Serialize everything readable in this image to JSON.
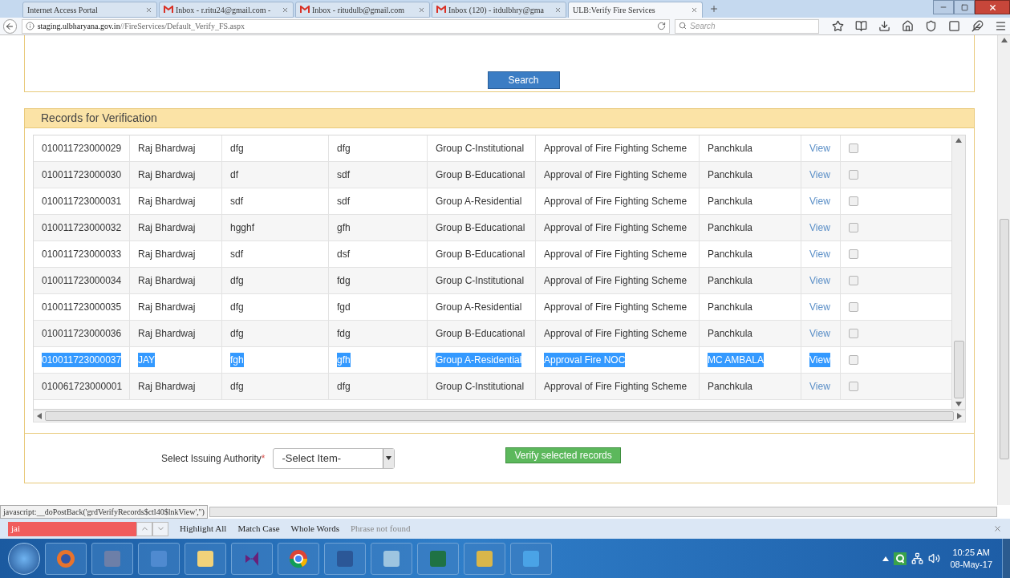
{
  "browser": {
    "tabs": [
      {
        "title": "Internet Access Portal",
        "mail": false,
        "selected": false
      },
      {
        "title": "Inbox - r.ritu24@gmail.com -",
        "mail": true,
        "selected": false
      },
      {
        "title": "Inbox - ritudulb@gmail.com",
        "mail": true,
        "selected": false
      },
      {
        "title": "Inbox (120) - itdulbhry@gma",
        "mail": true,
        "selected": false
      },
      {
        "title": "ULB:Verify Fire Services",
        "mail": false,
        "selected": true
      }
    ],
    "url_host": "staging.ulbharyana.gov.in",
    "url_path": "//FireServices/Default_Verify_FS.aspx",
    "search_placeholder": "Search"
  },
  "search_button": "Search",
  "records": {
    "title": "Records for Verification",
    "rows": [
      {
        "cells": [
          "010011723000029",
          "Raj Bhardwaj",
          "dfg",
          "dfg",
          "Group C-Institutional",
          "Approval of Fire Fighting Scheme",
          "Panchkula"
        ],
        "link": "View",
        "highlighted": false,
        "checked": false
      },
      {
        "cells": [
          "010011723000030",
          "Raj Bhardwaj",
          "df",
          "sdf",
          "Group B-Educational",
          "Approval of Fire Fighting Scheme",
          "Panchkula"
        ],
        "link": "View",
        "highlighted": false,
        "checked": false
      },
      {
        "cells": [
          "010011723000031",
          "Raj Bhardwaj",
          "sdf",
          "sdf",
          "Group A-Residential",
          "Approval of Fire Fighting Scheme",
          "Panchkula"
        ],
        "link": "View",
        "highlighted": false,
        "checked": false
      },
      {
        "cells": [
          "010011723000032",
          "Raj Bhardwaj",
          "hgghf",
          "gfh",
          "Group B-Educational",
          "Approval of Fire Fighting Scheme",
          "Panchkula"
        ],
        "link": "View",
        "highlighted": false,
        "checked": false
      },
      {
        "cells": [
          "010011723000033",
          "Raj Bhardwaj",
          "sdf",
          "dsf",
          "Group B-Educational",
          "Approval of Fire Fighting Scheme",
          "Panchkula"
        ],
        "link": "View",
        "highlighted": false,
        "checked": false
      },
      {
        "cells": [
          "010011723000034",
          "Raj Bhardwaj",
          "dfg",
          "fdg",
          "Group C-Institutional",
          "Approval of Fire Fighting Scheme",
          "Panchkula"
        ],
        "link": "View",
        "highlighted": false,
        "checked": false
      },
      {
        "cells": [
          "010011723000035",
          "Raj Bhardwaj",
          "dfg",
          "fgd",
          "Group A-Residential",
          "Approval of Fire Fighting Scheme",
          "Panchkula"
        ],
        "link": "View",
        "highlighted": false,
        "checked": false
      },
      {
        "cells": [
          "010011723000036",
          "Raj Bhardwaj",
          "dfg",
          "fdg",
          "Group B-Educational",
          "Approval of Fire Fighting Scheme",
          "Panchkula"
        ],
        "link": "View",
        "highlighted": false,
        "checked": false
      },
      {
        "cells": [
          "010011723000037",
          "JAY",
          "fgh",
          "gfh",
          "Group A-Residential",
          "Approval Fire NOC",
          "MC AMBALA"
        ],
        "link": "View",
        "highlighted": true,
        "checked": false
      },
      {
        "cells": [
          "010061723000001",
          "Raj Bhardwaj",
          "dfg",
          "dfg",
          "Group C-Institutional",
          "Approval of Fire Fighting Scheme",
          "Panchkula"
        ],
        "link": "View",
        "highlighted": false,
        "checked": false
      }
    ]
  },
  "authority": {
    "label": "Select Issuing Authority",
    "required_mark": "*",
    "value": "-Select Item-"
  },
  "verify_button": "Verify selected records",
  "status_url": "javascript:__doPostBack('grdVerifyRecords$ctl40$lnkView','')",
  "find_bar": {
    "query": "jai",
    "not_found": true,
    "options": [
      {
        "label": "Highlight All"
      },
      {
        "label": "Match Case"
      },
      {
        "label": "Whole Words"
      }
    ],
    "message": "Phrase not found"
  },
  "clock": {
    "time": "10:25 AM",
    "date": "08-May-17"
  }
}
